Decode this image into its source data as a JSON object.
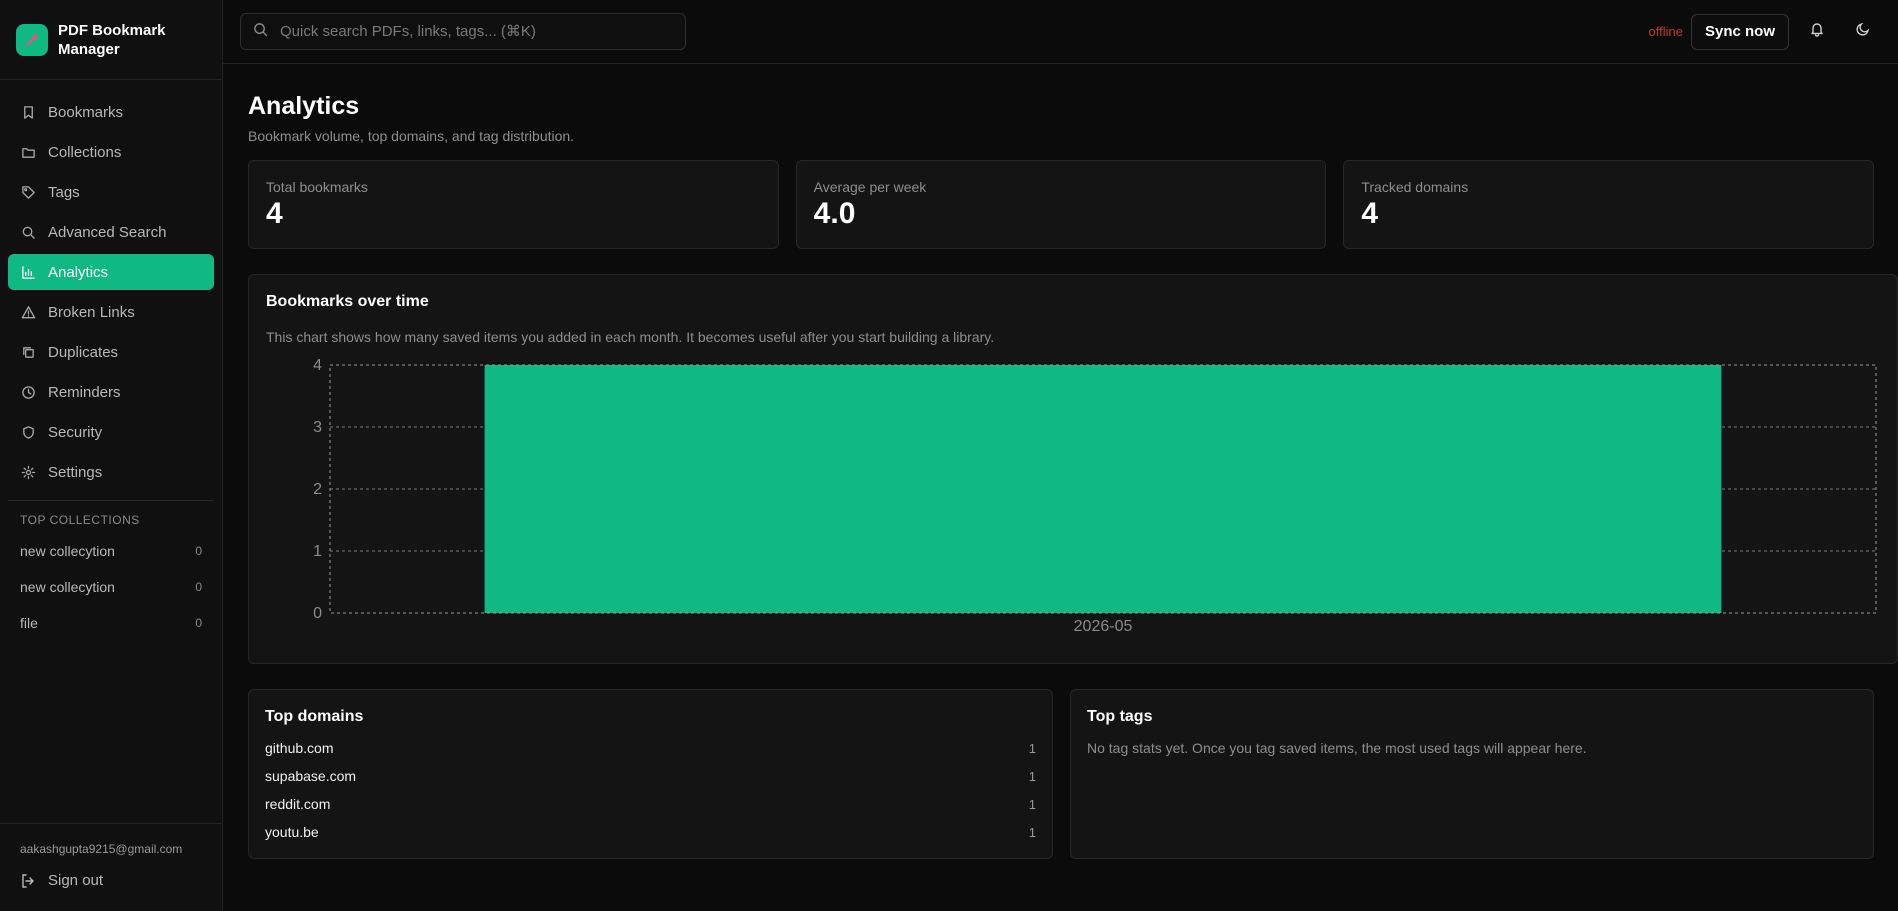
{
  "app": {
    "title": "PDF Bookmark Manager",
    "title_line1": "PDF Bookmark",
    "title_line2": "Manager"
  },
  "sidebar": {
    "items": [
      {
        "label": "Bookmarks",
        "icon": "bookmark-icon"
      },
      {
        "label": "Collections",
        "icon": "folder-icon"
      },
      {
        "label": "Tags",
        "icon": "tag-icon"
      },
      {
        "label": "Advanced Search",
        "icon": "search-icon"
      },
      {
        "label": "Analytics",
        "icon": "bar-chart-icon",
        "active": true
      },
      {
        "label": "Broken Links",
        "icon": "warning-icon"
      },
      {
        "label": "Duplicates",
        "icon": "copy-icon"
      },
      {
        "label": "Reminders",
        "icon": "clock-icon"
      },
      {
        "label": "Security",
        "icon": "shield-icon"
      },
      {
        "label": "Settings",
        "icon": "gear-icon"
      }
    ],
    "top_collections_label": "TOP COLLECTIONS",
    "collections": [
      {
        "name": "new collecytion",
        "count": "0"
      },
      {
        "name": "new collecytion",
        "count": "0"
      },
      {
        "name": "file",
        "count": "0"
      }
    ],
    "user_email": "aakashgupta9215@gmail.com",
    "sign_out": "Sign out"
  },
  "topbar": {
    "search_placeholder": "Quick search PDFs, links, tags... (⌘K)",
    "status": "offline",
    "sync_label": "Sync now"
  },
  "page": {
    "title": "Analytics",
    "subtitle": "Bookmark volume, top domains, and tag distribution."
  },
  "stats": [
    {
      "label": "Total bookmarks",
      "value": "4"
    },
    {
      "label": "Average per week",
      "value": "4.0"
    },
    {
      "label": "Tracked domains",
      "value": "4"
    }
  ],
  "chart_panel": {
    "title": "Bookmarks over time",
    "description": "This chart shows how many saved items you added in each month. It becomes useful after you start building a library."
  },
  "chart_data": {
    "type": "bar",
    "categories": [
      "2026-05"
    ],
    "values": [
      4
    ],
    "ylim": [
      0,
      4
    ],
    "yticks": [
      0,
      1,
      2,
      3,
      4
    ],
    "grid": true,
    "bar_color": "#10b981"
  },
  "top_domains": {
    "title": "Top domains",
    "rows": [
      {
        "domain": "github.com",
        "count": "1"
      },
      {
        "domain": "supabase.com",
        "count": "1"
      },
      {
        "domain": "reddit.com",
        "count": "1"
      },
      {
        "domain": "youtu.be",
        "count": "1"
      }
    ]
  },
  "top_tags": {
    "title": "Top tags",
    "empty_text": "No tag stats yet. Once you tag saved items, the most used tags will appear here."
  },
  "colors": {
    "accent": "#10b981",
    "offline": "#c0392b"
  }
}
